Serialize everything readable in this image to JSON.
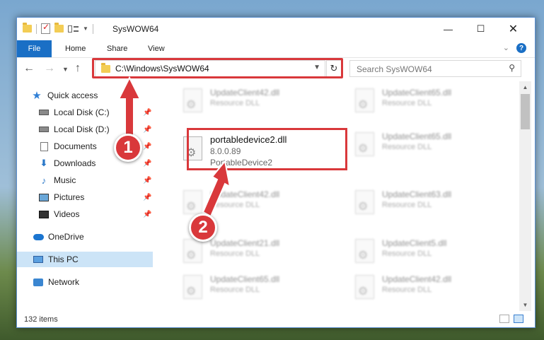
{
  "window": {
    "title": "SysWOW64"
  },
  "ribbon": {
    "file": "File",
    "tabs": [
      "Home",
      "Share",
      "View"
    ],
    "help": "?"
  },
  "address": {
    "path": "C:\\Windows\\SysWOW64"
  },
  "search": {
    "placeholder": "Search SysWOW64"
  },
  "sidebar": {
    "items": [
      {
        "label": "Quick access",
        "icon": "star-icon"
      },
      {
        "label": "Local Disk (C:)",
        "icon": "drive-icon",
        "pinned": true
      },
      {
        "label": "Local Disk (D:)",
        "icon": "drive-icon",
        "pinned": true
      },
      {
        "label": "Documents",
        "icon": "documents-icon",
        "pinned": true
      },
      {
        "label": "Downloads",
        "icon": "downloads-icon",
        "pinned": true
      },
      {
        "label": "Music",
        "icon": "music-icon",
        "pinned": true
      },
      {
        "label": "Pictures",
        "icon": "pictures-icon",
        "pinned": true
      },
      {
        "label": "Videos",
        "icon": "videos-icon",
        "pinned": true
      },
      {
        "label": "OneDrive",
        "icon": "onedrive-icon"
      },
      {
        "label": "This PC",
        "icon": "pc-icon",
        "selected": true
      },
      {
        "label": "Network",
        "icon": "network-icon"
      }
    ]
  },
  "files": {
    "highlighted": {
      "name": "portabledevice2.dll",
      "version": "8.0.0.89",
      "description": "PortableDevice2"
    },
    "blurred": [
      {
        "name": "UpdateClient42.dll",
        "description": "Resource DLL"
      },
      {
        "name": "UpdateClient65.dll",
        "description": "Resource DLL"
      },
      {
        "name": "UpdateClient65.dll",
        "description": "Resource DLL"
      },
      {
        "name": "UpdateClient42.dll",
        "description": "Resource DLL"
      },
      {
        "name": "UpdateClient63.dll",
        "description": "Resource DLL"
      },
      {
        "name": "UpdateClient21.dll",
        "description": "Resource DLL"
      },
      {
        "name": "UpdateClient5.dll",
        "description": "Resource DLL"
      },
      {
        "name": "UpdateClient65.dll",
        "description": "Resource DLL"
      },
      {
        "name": "UpdateClient42.dll",
        "description": "Resource DLL"
      }
    ]
  },
  "status": {
    "items_count": "132 items"
  },
  "callouts": {
    "step1": "1",
    "step2": "2"
  },
  "colors": {
    "accent": "#1a6fc5",
    "highlight": "#d9383b",
    "selected": "#cce4f7"
  }
}
